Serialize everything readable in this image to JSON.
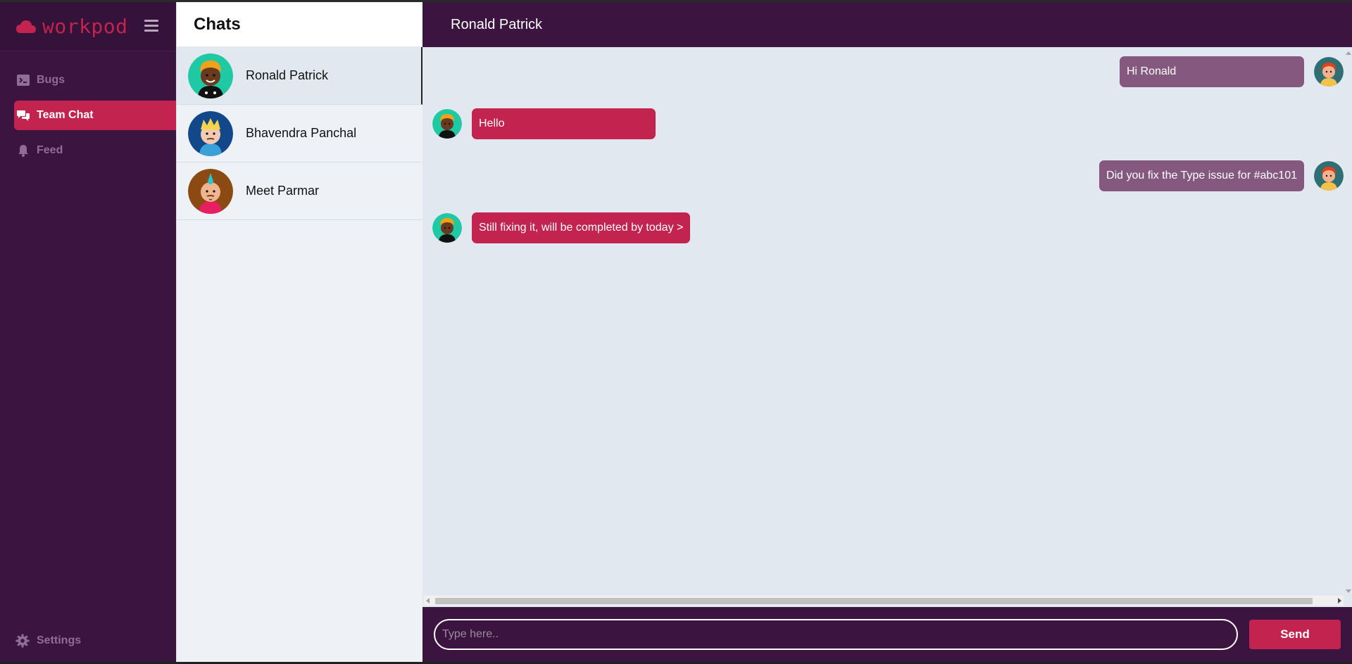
{
  "brand": {
    "name": "workpod"
  },
  "nav": {
    "items": [
      {
        "label": "Bugs",
        "icon": "terminal-icon",
        "active": false
      },
      {
        "label": "Team Chat",
        "icon": "chat-bubbles-icon",
        "active": true
      },
      {
        "label": "Feed",
        "icon": "bell-icon",
        "active": false
      }
    ],
    "settings_label": "Settings"
  },
  "chatlist": {
    "title": "Chats",
    "contacts": [
      {
        "name": "Ronald Patrick",
        "active": true
      },
      {
        "name": "Bhavendra Panchal",
        "active": false
      },
      {
        "name": "Meet Parmar",
        "active": false
      }
    ]
  },
  "conversation": {
    "title": "Ronald Patrick",
    "messages": [
      {
        "text": "Hi Ronald",
        "direction": "out"
      },
      {
        "text": "Hello",
        "direction": "in"
      },
      {
        "text": "Did you fix the Type issue for #abc101",
        "direction": "out"
      },
      {
        "text": "Still fixing it, will be completed by today >",
        "direction": "in"
      }
    ]
  },
  "composer": {
    "placeholder": "Type here..",
    "send_label": "Send"
  },
  "colors": {
    "sidebar": "#3b1540",
    "accent": "#c2244f",
    "outgoing_bubble": "#84587f",
    "chat_bg": "#e2e8f0"
  }
}
